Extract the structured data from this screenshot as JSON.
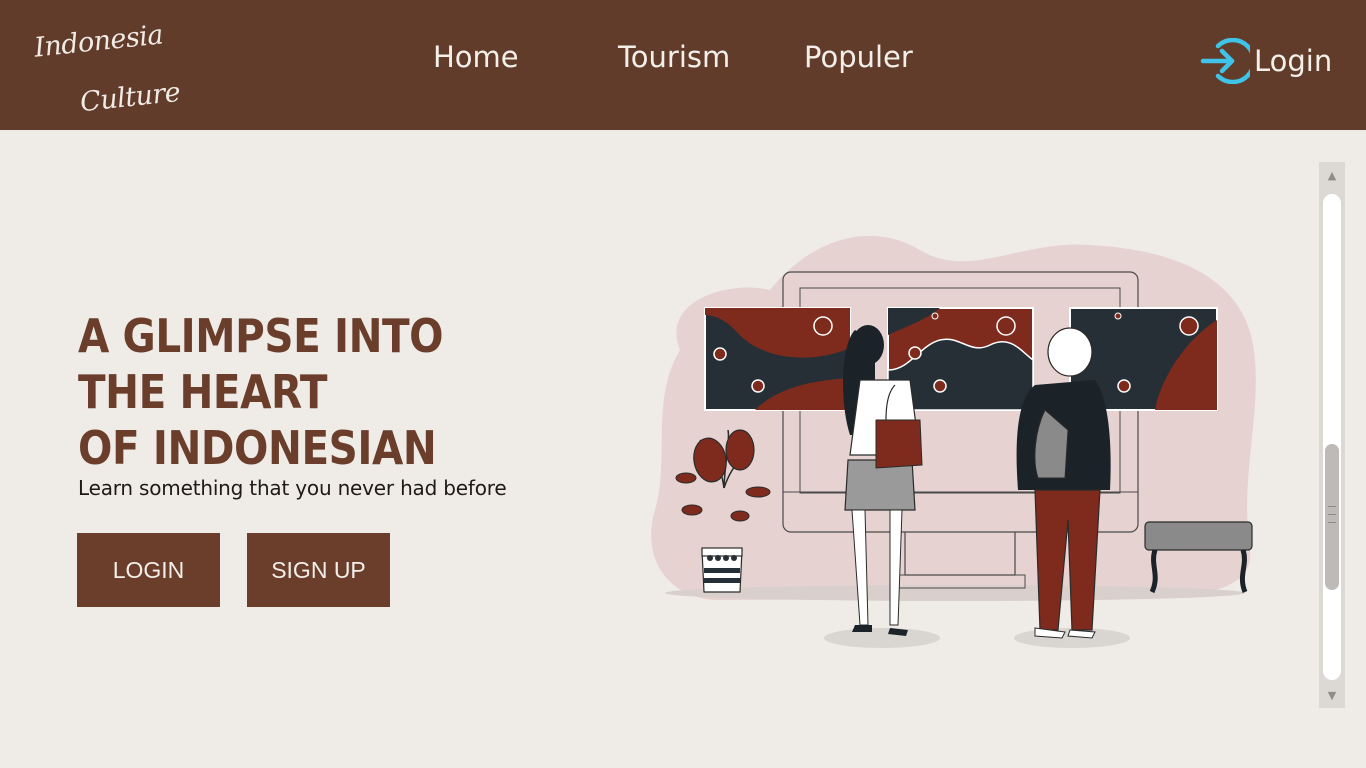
{
  "brand": {
    "line1": "Indonesia",
    "line2": "Culture"
  },
  "nav": {
    "links": [
      {
        "label": "Home"
      },
      {
        "label": "Tourism"
      },
      {
        "label": "Populer"
      }
    ],
    "login_label": "Login",
    "login_icon": "login-arrow-icon"
  },
  "hero": {
    "title_lines": [
      "A GLIMPSE INTO",
      "THE HEART",
      "OF INDONESIAN"
    ],
    "subtitle": "Learn something that you never had before",
    "buttons": {
      "login": "LOGIN",
      "signup": "SIGN UP"
    },
    "illustration": "people-viewing-gallery-art-illustration"
  },
  "colors": {
    "navbar": "#623c2b",
    "background": "#efebe6",
    "brand_brown": "#6a3e2b",
    "accent_red": "#7e2b1d",
    "dark_panel": "#252f35",
    "login_icon": "#3fc3e6"
  }
}
